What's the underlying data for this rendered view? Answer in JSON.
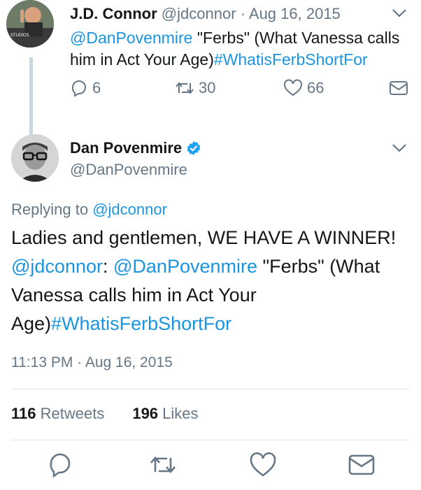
{
  "tweet_parent": {
    "name": "J.D. Connor",
    "handle": "@jdconnor",
    "separator": "·",
    "date": "Aug 16, 2015",
    "text_mention": "@DanPovenmire",
    "text_body": " \"Ferbs\" (What Vanessa calls him in Act Your Age)",
    "text_hashtag": "#WhatisFerbShortFor",
    "avatar_sign_text": "THE STUDIOS",
    "reply_count": "6",
    "retweet_count": "30",
    "like_count": "66"
  },
  "tweet_main": {
    "name": "Dan Povenmire",
    "handle": "@DanPovenmire",
    "replying_prefix": "Replying to ",
    "replying_to": "@jdconnor",
    "line1": "Ladies and gentlemen, WE HAVE A WINNER!",
    "quoted_user": "@jdconnor",
    "colon": ": ",
    "mention": "@DanPovenmire",
    "body": " \"Ferbs\" (What Vanessa calls him in Act Your Age)",
    "hashtag": "#WhatisFerbShortFor",
    "timestamp": "11:13 PM · Aug 16, 2015",
    "retweets_count": "116",
    "retweets_label": " Retweets",
    "likes_count": "196",
    "likes_label": " Likes"
  },
  "colors": {
    "link": "#1b95e0",
    "muted": "#657786",
    "verified": "#1da1f2",
    "divider": "#e1e8ed"
  },
  "icons": [
    "reply-icon",
    "retweet-icon",
    "like-icon",
    "direct-message-icon",
    "chevron-down-icon",
    "verified-badge-icon"
  ]
}
